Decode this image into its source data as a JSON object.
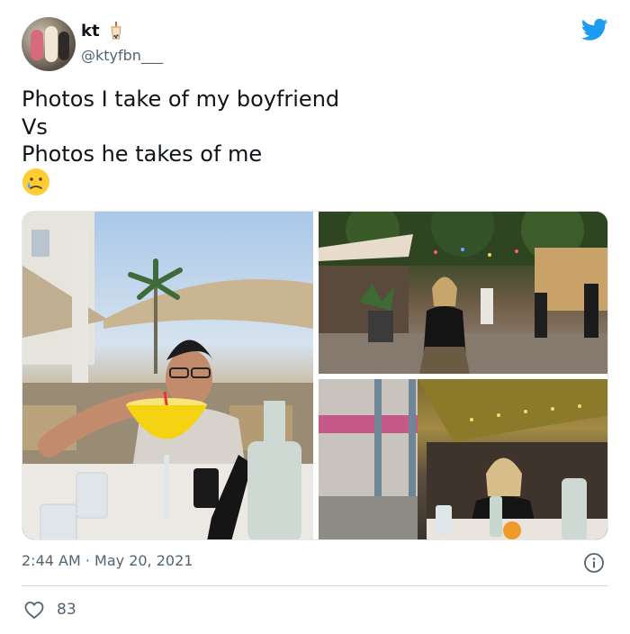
{
  "user": {
    "name": "kt",
    "handle": "@ktyfbn___"
  },
  "tweet": {
    "lines": [
      "Photos I take of my boyfriend",
      "Vs",
      "Photos he takes of me"
    ],
    "emoji": "crying-face-icon"
  },
  "photos": [
    {
      "name": "boyfriend-photo"
    },
    {
      "name": "girlfriend-photo-street"
    },
    {
      "name": "girlfriend-photo-table"
    }
  ],
  "meta": {
    "time": "2:44 AM",
    "separator": "·",
    "date": "May 20, 2021",
    "timestamp": "2:44 AM · May 20, 2021"
  },
  "stats": {
    "likes": "83"
  },
  "colors": {
    "twitter_blue": "#1d9bf0",
    "secondary_text": "#536471",
    "primary_text": "#0f1419"
  }
}
